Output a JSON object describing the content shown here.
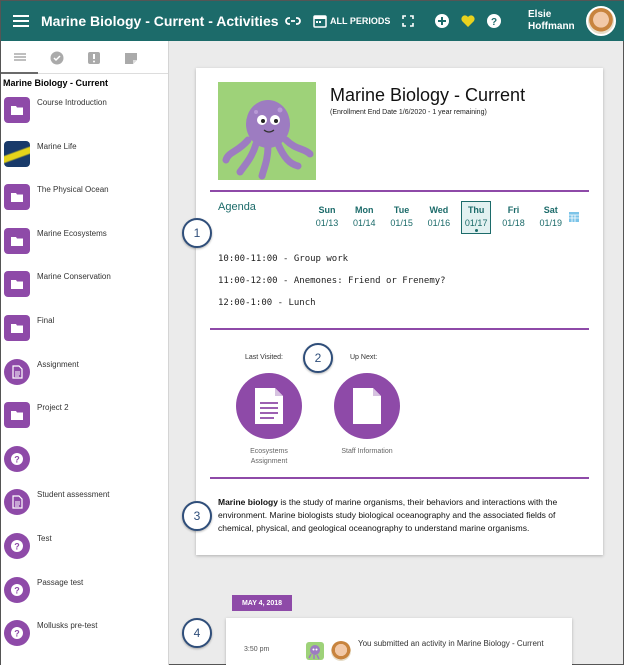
{
  "header": {
    "title": "Marine Biology - Current - Activities",
    "period_label": "ALL PERIODS",
    "user_first": "Elsie",
    "user_last": "Hoffmann"
  },
  "sidebar": {
    "course_title": "Marine Biology - Current",
    "items": [
      {
        "label": "Course Introduction",
        "icon": "folder-icon"
      },
      {
        "label": "Marine Life",
        "icon": "image-thumbnail"
      },
      {
        "label": "The Physical Ocean",
        "icon": "folder-icon"
      },
      {
        "label": "Marine Ecosystems",
        "icon": "folder-icon"
      },
      {
        "label": "Marine Conservation",
        "icon": "folder-icon"
      },
      {
        "label": "Final",
        "icon": "folder-icon"
      },
      {
        "label": "Assignment",
        "icon": "document-icon"
      },
      {
        "label": "Project 2",
        "icon": "folder-icon"
      },
      {
        "label": "",
        "icon": "question-icon"
      },
      {
        "label": "Student assessment",
        "icon": "document-icon"
      },
      {
        "label": "Test",
        "icon": "question-icon"
      },
      {
        "label": "Passage test",
        "icon": "question-icon"
      },
      {
        "label": "Mollusks pre-test",
        "icon": "question-icon"
      }
    ]
  },
  "course": {
    "title": "Marine Biology - Current",
    "enrollment_note": "(Enrollment End Date 1/6/2020 - 1 year remaining)"
  },
  "agenda": {
    "title": "Agenda",
    "days": [
      {
        "name": "Sun",
        "date": "01/13"
      },
      {
        "name": "Mon",
        "date": "01/14"
      },
      {
        "name": "Tue",
        "date": "01/15"
      },
      {
        "name": "Wed",
        "date": "01/16"
      },
      {
        "name": "Thu",
        "date": "01/17"
      },
      {
        "name": "Fri",
        "date": "01/18"
      },
      {
        "name": "Sat",
        "date": "01/19"
      }
    ],
    "selected_day": "Thu",
    "items": [
      "10:00-11:00 - Group work",
      "11:00-12:00 - Anemones: Friend or Frenemy?",
      "12:00-1:00 - Lunch"
    ]
  },
  "navigation": {
    "last_visited_label": "Last Visited:",
    "up_next_label": "Up Next:",
    "last_visited_caption_1": "Ecosystems",
    "last_visited_caption_2": "Assignment",
    "up_next_caption": "Staff Information"
  },
  "description": {
    "bold": "Marine biology",
    "text": " is the study of marine organisms, their behaviors and interactions with the environment. Marine biologists study biological oceanography and the associated fields of chemical, physical, and geological oceanography to understand marine organisms."
  },
  "feed": {
    "date": "MAY 4, 2018",
    "time": "3:50 pm",
    "message": "You submitted an activity in Marine Biology - Current"
  },
  "markers": [
    "1",
    "2",
    "3",
    "4"
  ],
  "colors": {
    "header": "#1c6b6a",
    "accent": "#8e4aa8",
    "date_text": "#1c6b6a"
  }
}
